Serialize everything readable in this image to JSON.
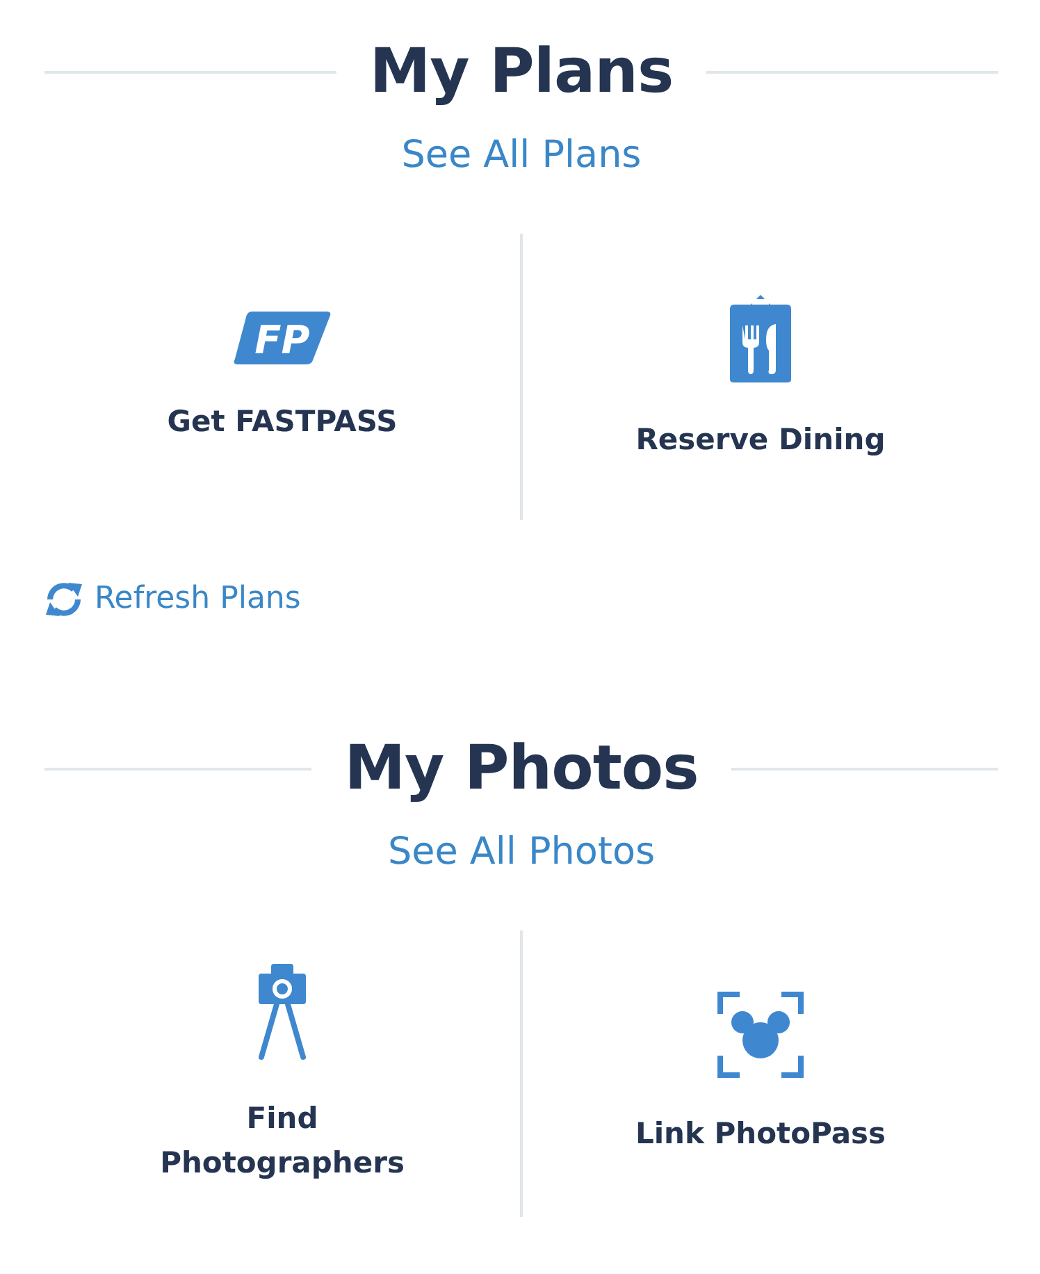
{
  "sections": [
    {
      "title": "My Plans",
      "link": "See All Plans",
      "actions": [
        {
          "kind": "fastpass",
          "icon_text": "FP",
          "label": "Get FASTPASS"
        },
        {
          "kind": "dining",
          "label": "Reserve Dining"
        }
      ],
      "refresh": "Refresh Plans"
    },
    {
      "title": "My Photos",
      "link": "See All Photos",
      "actions": [
        {
          "kind": "photographer",
          "label": "Find Photographers"
        },
        {
          "kind": "photopass",
          "label": "Link PhotoPass"
        }
      ]
    }
  ]
}
